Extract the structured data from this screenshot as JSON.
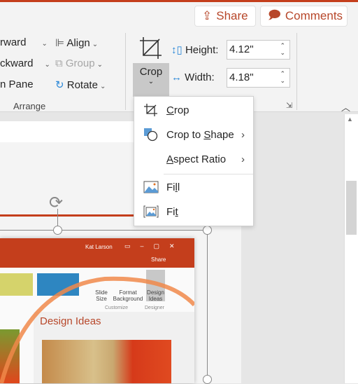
{
  "header": {
    "share_label": "Share",
    "comments_label": "Comments"
  },
  "arrange": {
    "forward": "rward",
    "backward": "ckward",
    "pane": "n Pane",
    "align": "Align",
    "group": "Group",
    "rotate": "Rotate",
    "group_label": "Arrange"
  },
  "size": {
    "crop_label": "Crop",
    "height_label": "Height:",
    "height_value": "4.12\"",
    "width_label": "Width:",
    "width_value": "4.18\""
  },
  "crop_menu": {
    "items": [
      {
        "pre": "",
        "u": "C",
        "post": "rop",
        "icon": "crop-icon"
      },
      {
        "pre": "Crop to ",
        "u": "S",
        "post": "hape",
        "icon": "crop-to-shape-icon",
        "submenu": true
      },
      {
        "pre": "",
        "u": "A",
        "post": "spect Ratio",
        "icon": "",
        "submenu": true
      },
      {
        "pre": "Fi",
        "u": "l",
        "post": "l",
        "icon": "fill-icon"
      },
      {
        "pre": "Fi",
        "u": "t",
        "post": "",
        "icon": "fit-icon"
      }
    ]
  },
  "embedded": {
    "user": "Kat Larson",
    "share": "Share",
    "slide_size": "Slide Size",
    "format_bg": "Format Background",
    "design_ideas": "Design Ideas",
    "customize": "Customize",
    "designer": "Designer",
    "pane_title": "Design Ideas"
  },
  "colors": {
    "accent": "#b7472a",
    "title_bar": "#c43e1c",
    "highlight": "#f0884a"
  }
}
